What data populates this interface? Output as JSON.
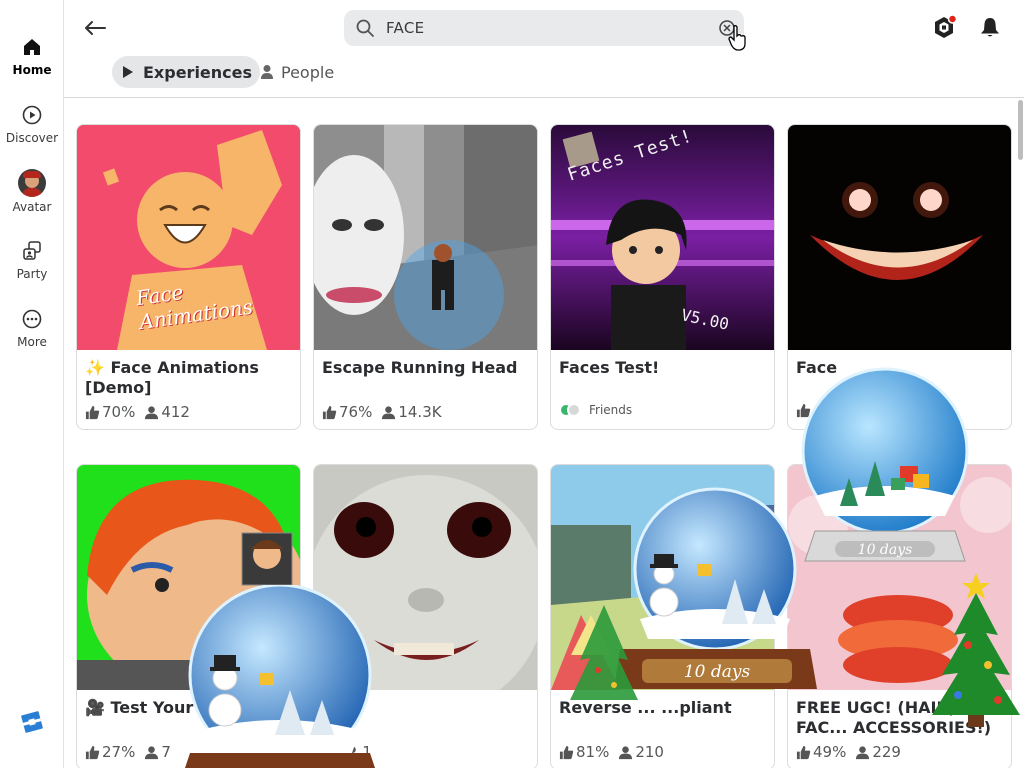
{
  "sidebar": {
    "items": [
      {
        "label": "Home",
        "icon": "home-icon",
        "active": true
      },
      {
        "label": "Discover",
        "icon": "discover-icon"
      },
      {
        "label": "Avatar",
        "icon": "avatar-icon"
      },
      {
        "label": "Party",
        "icon": "party-icon"
      },
      {
        "label": "More",
        "icon": "more-icon"
      }
    ],
    "logo": "roblox-logo"
  },
  "header": {
    "search": {
      "value": "FACE",
      "placeholder": "Search"
    },
    "tabs": [
      {
        "label": "Experiences",
        "icon": "play-icon",
        "active": true
      },
      {
        "label": "People",
        "icon": "person-icon"
      }
    ]
  },
  "results": [
    {
      "title": "✨ Face Animations [Demo]",
      "rating": "70%",
      "players": "412"
    },
    {
      "title": "Escape Running Head",
      "rating": "76%",
      "players": "14.3K"
    },
    {
      "title": "Faces Test!",
      "friends_label": "Friends"
    },
    {
      "title": "Face",
      "rating": "",
      "players": ""
    },
    {
      "title": "🎥 Test Your Animation",
      "rating": "27%",
      "players": "7"
    },
    {
      "title": "",
      "rating": "%",
      "players": "1"
    },
    {
      "title": "Reverse ... ...pliant",
      "rating": "81%",
      "players": "210"
    },
    {
      "title": "FREE UGC! (HAIR, FAC... ACCESSORIES!)",
      "rating": "49%",
      "players": "229"
    }
  ],
  "thumb_text": {
    "t1": "Face Animations",
    "t3a": "Faces Test!",
    "t3b": "V5.00"
  },
  "overlay": {
    "globe_label": "10 days"
  },
  "colors": {
    "accent_red": "#e2231a",
    "card_border": "#dcdcdc",
    "tab_bg": "#e5e6e8",
    "search_bg": "#e9eaec"
  }
}
